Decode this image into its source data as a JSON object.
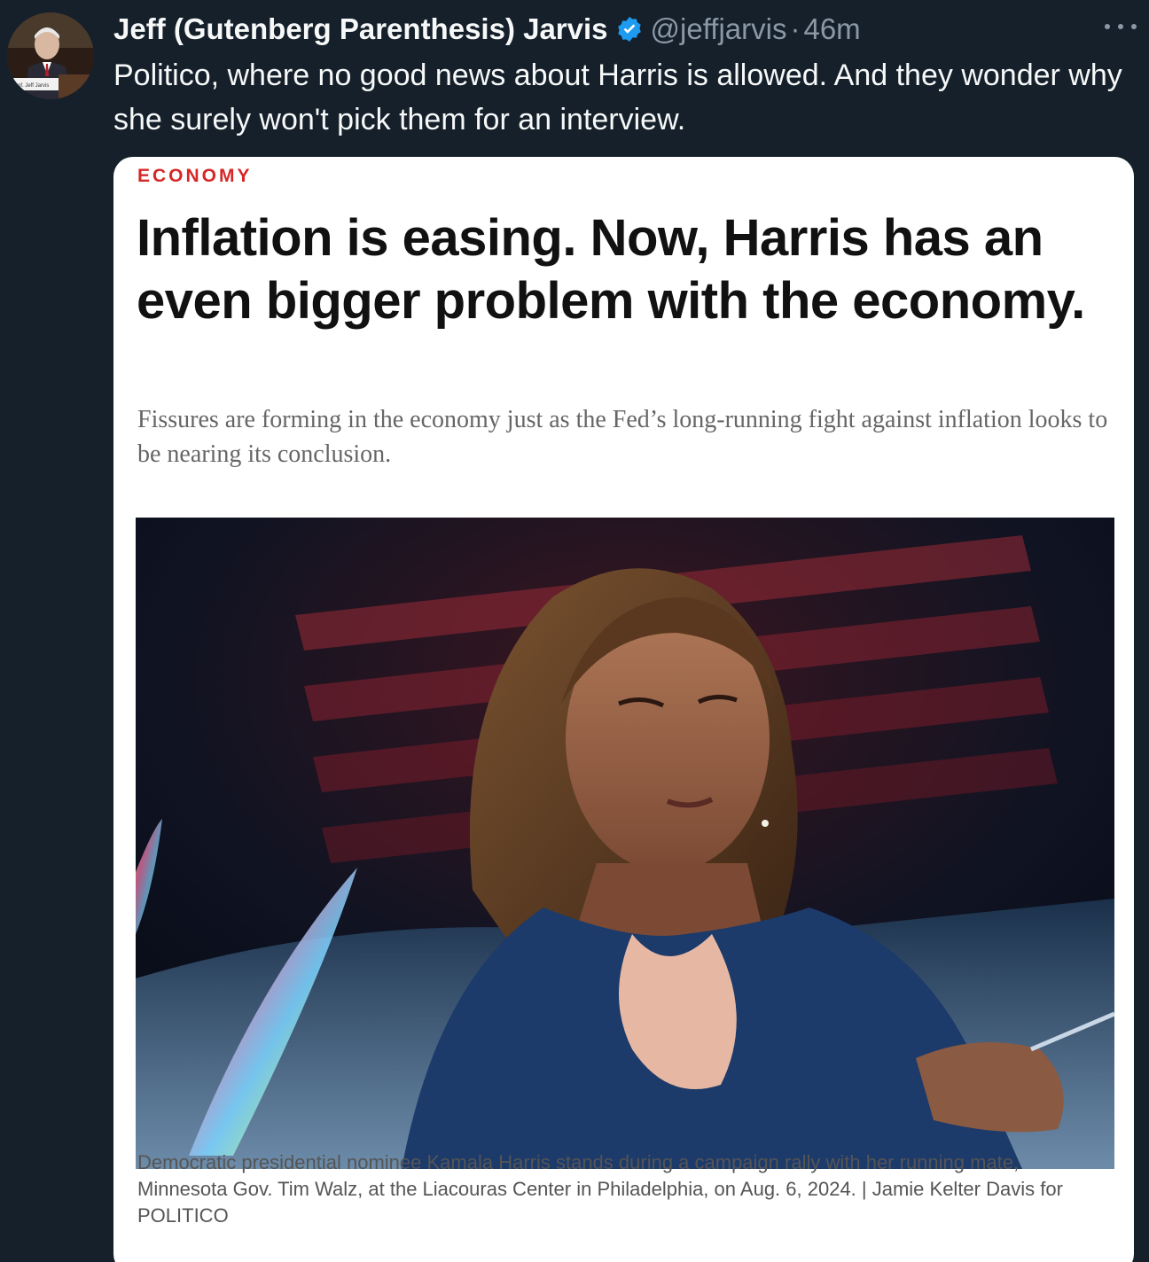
{
  "tweet": {
    "author": {
      "display_name": "Jeff (Gutenberg Parenthesis) Jarvis",
      "handle": "@jeffjarvis",
      "verified_icon": "verified-badge-icon",
      "avatar_label": "Prof. Jeff Jarvis"
    },
    "separator": "·",
    "time": "46m",
    "more_icon": "more-horizontal-icon",
    "text": "Politico, where no good news about Harris is allowed. And they wonder why she surely won't pick them for an interview."
  },
  "article": {
    "kicker": "ECONOMY",
    "headline": "Inflation is easing. Now, Harris has an even bigger problem with the economy.",
    "dek": "Fissures are forming in the economy just as the Fed’s long-running fight against inflation looks to be nearing its conclusion.",
    "photo_caption": "Democratic presidential nominee Kamala Harris stands during a campaign rally with her running mate, Minnesota Gov. Tim Walz, at the Liacouras Center in Philadelphia, on Aug. 6, 2024. | Jamie Kelter Davis for POLITICO"
  },
  "colors": {
    "background": "#15202b",
    "text_primary": "#f7f9f9",
    "text_secondary": "#8b98a5",
    "verified_blue": "#1d9bf0",
    "kicker_red": "#d62828"
  }
}
